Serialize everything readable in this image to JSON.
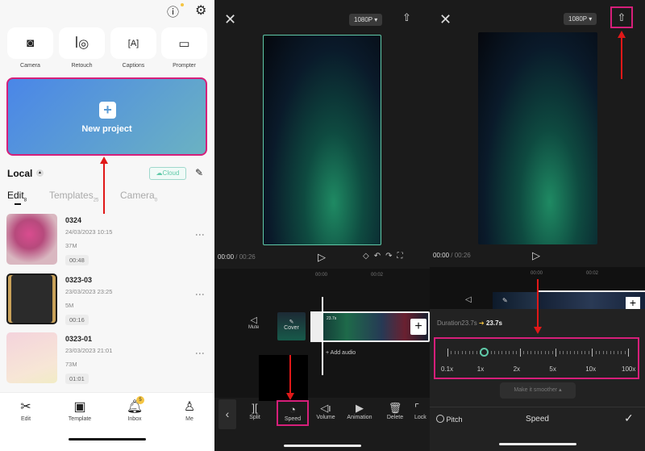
{
  "home": {
    "tools": [
      {
        "label": "Camera",
        "icon": "camera-icon"
      },
      {
        "label": "Retouch",
        "icon": "retouch-icon"
      },
      {
        "label": "Captions",
        "icon": "captions-icon"
      },
      {
        "label": "Prompter",
        "icon": "prompter-icon"
      }
    ],
    "new_project": "New project",
    "local": "Local",
    "cloud": "Cloud",
    "tabs": [
      {
        "label": "Edit",
        "count": "8"
      },
      {
        "label": "Templates",
        "count": "25"
      },
      {
        "label": "Camera",
        "count": "0"
      }
    ],
    "projects": [
      {
        "title": "0324",
        "date": "24/03/2023 10:15",
        "size": "37M",
        "duration": "00:48"
      },
      {
        "title": "0323-03",
        "date": "23/03/2023 23:25",
        "size": "5M",
        "duration": "00:16"
      },
      {
        "title": "0323-01",
        "date": "23/03/2023 21:01",
        "size": "73M",
        "duration": "01:01"
      }
    ],
    "nav": [
      {
        "label": "Edit",
        "icon": "scissors-icon"
      },
      {
        "label": "Template",
        "icon": "template-icon"
      },
      {
        "label": "Inbox",
        "icon": "bell-icon",
        "badge": "5"
      },
      {
        "label": "Me",
        "icon": "person-icon"
      }
    ]
  },
  "editor": {
    "resolution": "1080P",
    "time_current": "00:00",
    "time_total": "/ 00:26",
    "ruler": [
      "00:00",
      "00:02"
    ],
    "mute": "Mute",
    "cover": "Cover",
    "clip_duration": "23.7s",
    "add_audio": "+ Add audio",
    "toolbar": [
      "Split",
      "Speed",
      "Volume",
      "Animation",
      "Delete",
      "Lock"
    ]
  },
  "speed": {
    "resolution": "1080P",
    "time_current": "00:00",
    "time_total": "/ 00:26",
    "ruler": [
      "00:00",
      "00:02"
    ],
    "duration_label": "Duration23.7s",
    "duration_new": "23.7s",
    "marks": [
      "0.1x",
      "1x",
      "2x",
      "5x",
      "10x",
      "100x"
    ],
    "current_speed": "1x",
    "smoother": "Make it smoother",
    "pitch": "Pitch",
    "title": "Speed"
  },
  "colors": {
    "highlight": "#d61f7a",
    "arrow": "#e01818",
    "accent": "#5fc9a8"
  }
}
